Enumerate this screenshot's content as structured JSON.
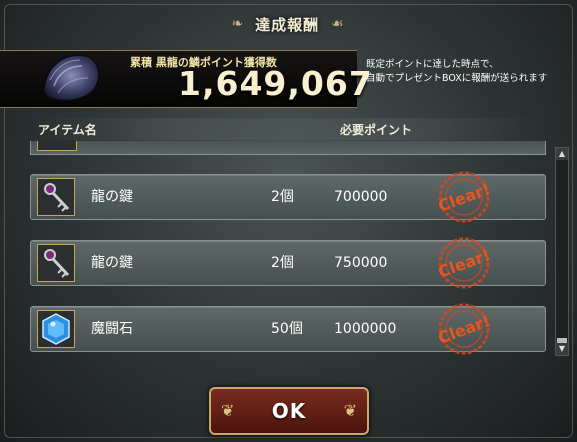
{
  "dialog": {
    "title": "達成報酬",
    "points_label": "累積 黒龍の鱗ポイント獲得数",
    "points_value": "1,649,067",
    "note_line1": "既定ポイントに達した時点で、",
    "note_line2": "自動でプレゼントBOXに報酬が送られます"
  },
  "table": {
    "col_item": "アイテム名",
    "col_required": "必要ポイント",
    "rows": [
      {
        "name": "龍の鍵",
        "qty": "2個",
        "required": "700000",
        "status": "Clear!",
        "icon": "dragon-key-icon"
      },
      {
        "name": "龍の鍵",
        "qty": "2個",
        "required": "750000",
        "status": "Clear!",
        "icon": "dragon-key-icon"
      },
      {
        "name": "魔闘石",
        "qty": "50個",
        "required": "1000000",
        "status": "Clear!",
        "icon": "blue-gem-icon"
      }
    ]
  },
  "ok_button": {
    "label": "OK"
  },
  "colors": {
    "stamp": "#e0451e",
    "gold": "#c4a45e",
    "row": "#56605f"
  }
}
